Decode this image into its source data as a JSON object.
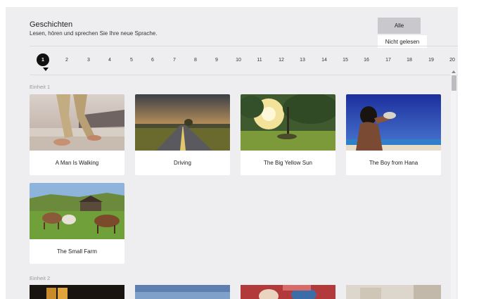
{
  "header": {
    "title": "Geschichten",
    "subtitle": "Lesen, hören und sprechen Sie Ihre neue Sprache."
  },
  "filters": {
    "all_label": "Alle",
    "unread_label": "Nicht gelesen",
    "selected": "Alle"
  },
  "pagination": {
    "pages": [
      "1",
      "2",
      "3",
      "4",
      "5",
      "6",
      "7",
      "8",
      "9",
      "10",
      "11",
      "12",
      "13",
      "14",
      "15",
      "16",
      "17",
      "18",
      "19",
      "20"
    ],
    "active": "1"
  },
  "units": [
    {
      "label": "Einheit 1",
      "stories": [
        {
          "title": "A Man Is Walking"
        },
        {
          "title": "Driving"
        },
        {
          "title": "The Big Yellow Sun"
        },
        {
          "title": "The Boy from Hana"
        },
        {
          "title": "The Small Farm"
        }
      ]
    },
    {
      "label": "Einheit 2"
    }
  ],
  "colors": {
    "panel_background": "#eeeef0",
    "card_background": "#ffffff",
    "active_page": "#111111",
    "filter_selected": "#c9c9cd"
  }
}
